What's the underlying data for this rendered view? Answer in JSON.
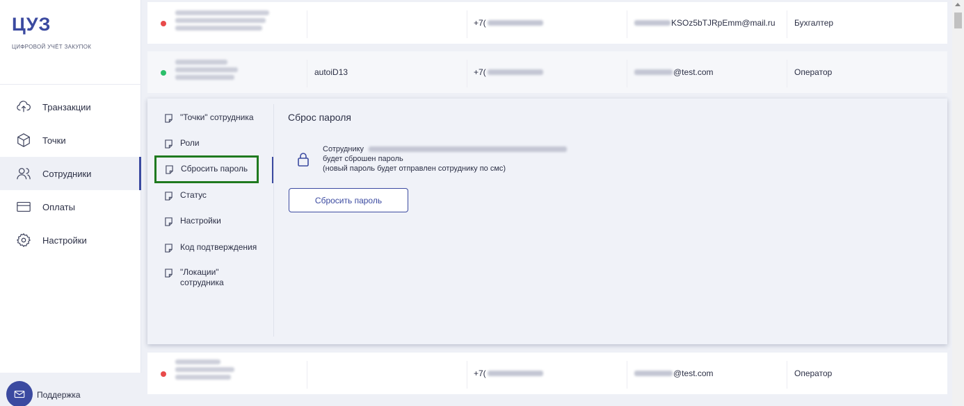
{
  "app": {
    "logo": "ЦУЗ",
    "logo_sub": "ЦИФРОВОЙ УЧЁТ ЗАКУПОК"
  },
  "nav": {
    "items": [
      {
        "label": "Транзакции",
        "icon": "cloud-upload-icon"
      },
      {
        "label": "Точки",
        "icon": "box-icon"
      },
      {
        "label": "Сотрудники",
        "icon": "users-icon",
        "active": true
      },
      {
        "label": "Оплаты",
        "icon": "card-icon"
      },
      {
        "label": "Настройки",
        "icon": "gear-icon"
      }
    ]
  },
  "support": {
    "label": "Поддержка",
    "icon": "mail-icon"
  },
  "rows": [
    {
      "status": "inactive",
      "status_color": "#e84a4a",
      "login": "",
      "phone": "+7(",
      "email": "KSOz5bTJRpEmm@mail.ru",
      "role": "Бухгалтер"
    },
    {
      "status": "active",
      "status_color": "#2bbf6a",
      "login": "autoiD13",
      "phone": "+7(",
      "email": "@test.com",
      "role": "Оператор"
    },
    {
      "status": "inactive",
      "status_color": "#e84a4a",
      "login": "",
      "phone": "+7(",
      "email": "@test.com",
      "role": "Оператор"
    }
  ],
  "panel": {
    "submenu": [
      {
        "label": "\"Точки\" сотрудника"
      },
      {
        "label": "Роли"
      },
      {
        "label": "Сбросить пароль",
        "active": true
      },
      {
        "label": "Статус"
      },
      {
        "label": "Настройки"
      },
      {
        "label": "Код подтверждения"
      },
      {
        "label": "\"Локации\" сотрудника"
      }
    ],
    "title": "Сброс пароля",
    "text_line1": "Сотруднику",
    "text_line2": "будет сброшен пароль",
    "text_line3": "(новый пароль будет отправлен сотруднику по смс)",
    "button_label": "Сбросить пароль"
  },
  "colors": {
    "accent": "#3b4aa0",
    "highlight_border": "#1f7a1f"
  }
}
